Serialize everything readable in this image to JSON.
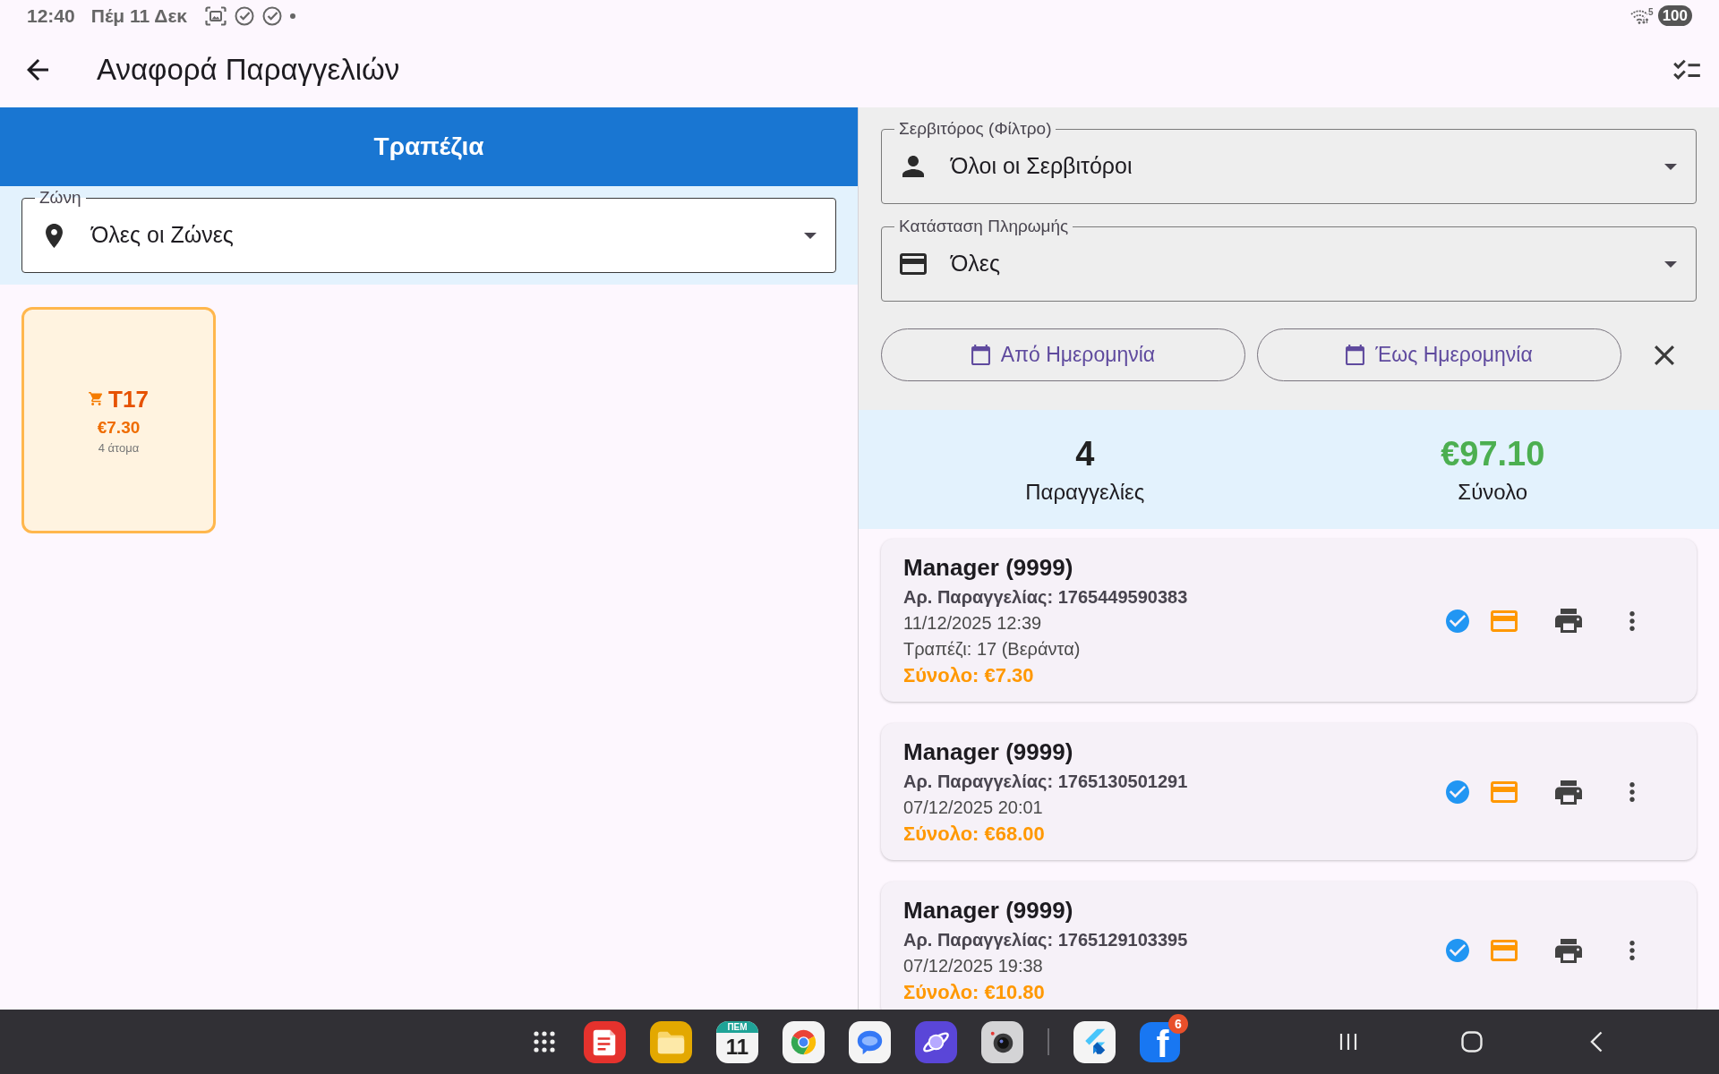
{
  "status_bar": {
    "time": "12:40",
    "date": "Πέμ 11 Δεκ",
    "wifi_label": "5",
    "battery": "100"
  },
  "app_bar": {
    "title": "Αναφορά Παραγγελιών"
  },
  "tables_panel": {
    "header": "Τραπέζια",
    "zone_filter": {
      "label": "Ζώνη",
      "value": "Όλες οι Ζώνες"
    },
    "tables": [
      {
        "name": "T17",
        "amount": "€7.30",
        "guests": "4 άτομα",
        "occupied": true
      }
    ]
  },
  "filters": {
    "waiter": {
      "label": "Σερβιτόρος (Φίλτρο)",
      "value": "Όλοι οι Σερβιτόροι"
    },
    "payment_status": {
      "label": "Κατάσταση Πληρωμής",
      "value": "Όλες"
    },
    "date_from": "Από Ημερομηνία",
    "date_to": "Έως Ημερομηνία"
  },
  "summary": {
    "count": "4",
    "count_label": "Παραγγελίες",
    "total": "€97.10",
    "total_label": "Σύνολο"
  },
  "orders": [
    {
      "waiter": "Manager (9999)",
      "order_number": "Αρ. Παραγγελίας: 1765449590383",
      "datetime": "11/12/2025 12:39",
      "table": "Τραπέζι: 17 (Βεράντα)",
      "total": "Σύνολο: €7.30",
      "paid": true
    },
    {
      "waiter": "Manager (9999)",
      "order_number": "Αρ. Παραγγελίας: 1765130501291",
      "datetime": "07/12/2025 20:01",
      "total": "Σύνολο: €68.00",
      "paid": true
    },
    {
      "waiter": "Manager (9999)",
      "order_number": "Αρ. Παραγγελίας: 1765129103395",
      "datetime": "07/12/2025 19:38",
      "total": "Σύνολο: €10.80",
      "paid": true
    }
  ],
  "taskbar": {
    "calendar_weekday": "ΠΕΜ",
    "calendar_day": "11",
    "social_app_letter": "f",
    "notification_badge": "6"
  }
}
